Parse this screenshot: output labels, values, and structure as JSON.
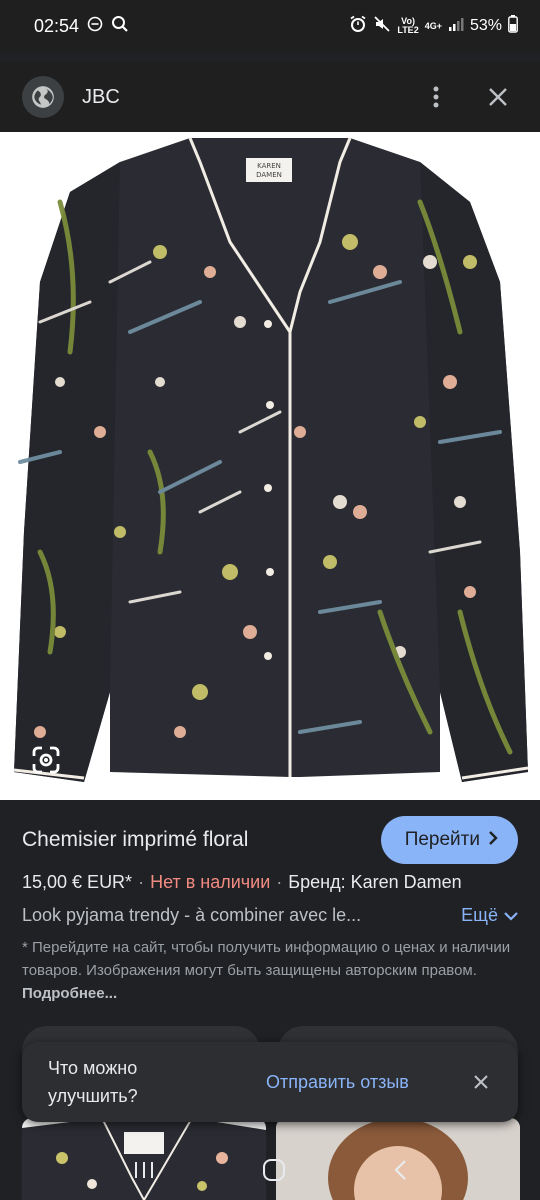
{
  "status_bar": {
    "time": "02:54",
    "battery": "53%",
    "volte_label": "Vo)\nLTE2",
    "network_label": "4G+"
  },
  "header": {
    "site_name": "JBC"
  },
  "product": {
    "title": "Chemisier imprimé floral",
    "visit_button": "Перейти",
    "price": "15,00 € EUR*",
    "stock_status": "Нет в наличии",
    "brand": "Бренд: Karen Damen",
    "description": "Look pyjama trendy - à combiner avec le...",
    "more_label": "Ещё",
    "disclaimer": "* Перейдите на сайт, чтобы получить информацию о ценах и наличии товаров. Изображения могут быть защищены авторским правом.",
    "disclaimer_link": "Подробнее..."
  },
  "snackbar": {
    "message": "Что можно улучшить?",
    "action": "Отправить отзыв"
  },
  "colors": {
    "accent": "#8ab4f8",
    "out_of_stock": "#f28b82",
    "background": "#202124"
  }
}
